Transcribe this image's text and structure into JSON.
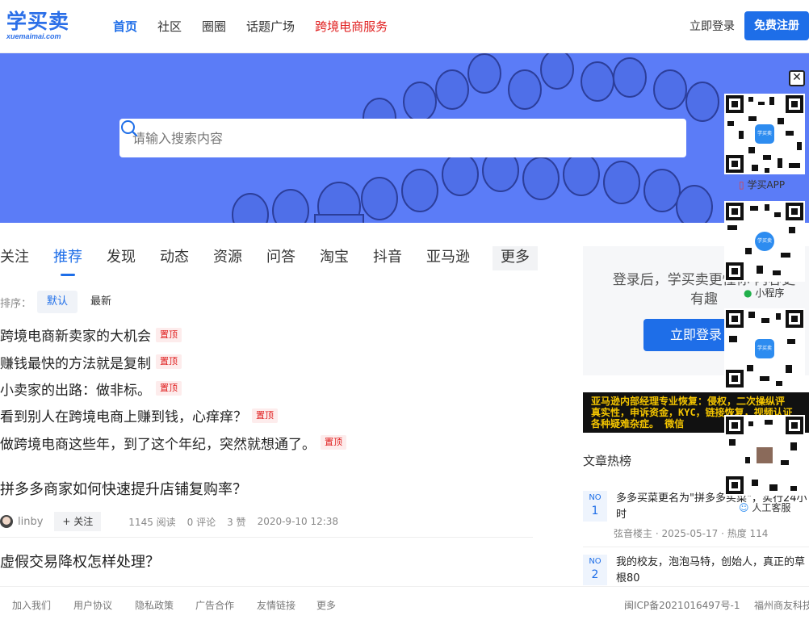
{
  "header": {
    "logo_main": "学买卖",
    "logo_sub": "xuemaimai.com",
    "nav": [
      "首页",
      "社区",
      "圈圈",
      "话题广场",
      "跨境电商服务"
    ],
    "login": "立即登录",
    "register": "免费注册"
  },
  "search": {
    "placeholder": "请输入搜索内容"
  },
  "tabs": [
    "关注",
    "推荐",
    "发现",
    "动态",
    "资源",
    "问答",
    "淘宝",
    "抖音",
    "亚马逊",
    "更多"
  ],
  "sort": {
    "label": "排序：",
    "options": [
      "默认",
      "最新"
    ]
  },
  "pinned": {
    "tag": "置顶",
    "items": [
      "跨境电商新卖家的大机会",
      "赚钱最快的方法就是复制",
      "小卖家的出路：做非标。",
      "看到别人在跨境电商上赚到钱，心痒痒？",
      "做跨境电商这些年，到了这个年纪，突然就想通了。"
    ]
  },
  "articles": [
    {
      "title": "拼多多商家如何快速提升店铺复购率？",
      "author": "linby",
      "follow": "+ 关注",
      "reads": "1145 阅读",
      "comments": "0 评论",
      "likes": "3 赞",
      "date": "2020-9-10 12:38"
    },
    {
      "title": "虚假交易降权怎样处理？",
      "author": "",
      "follow": "",
      "reads": "",
      "comments": "",
      "likes": "",
      "date": ""
    }
  ],
  "login_card": {
    "text": "登录后，学买卖更懂你 内容更有趣",
    "button": "立即登录"
  },
  "ad": {
    "line1": "亚马逊内部经理专业恢复：侵权，二次操纵评",
    "line2": "真实性，申诉资金，KYC，链接恢复，视频认证",
    "line3": "各种疑难杂症。        微信"
  },
  "hot": {
    "title": "文章热榜",
    "items": [
      {
        "no": "NO",
        "num": "1",
        "text": "多多买菜更名为\"拼多多买菜\"，实行24小时",
        "author": "弦音楼主",
        "date": "2025-05-17",
        "heat": "热度 114"
      },
      {
        "no": "NO",
        "num": "2",
        "text": "我的校友，泡泡马特，创始人，真正的草根80",
        "author": "",
        "date": "",
        "heat": ""
      }
    ]
  },
  "side": {
    "close": "✕",
    "app_label": "学买APP",
    "mini_label": "小程序",
    "service_label": "人工客服",
    "badge": "学买卖"
  },
  "footer": {
    "links": [
      "加入我们",
      "用户协议",
      "隐私政策",
      "广告合作",
      "友情链接",
      "更多"
    ],
    "icp": "闽ICP备2021016497号-1",
    "company": "福州商友科技"
  },
  "colors": {
    "brand": "#1e6ee8",
    "banner": "#5b7cf7",
    "pin": "#e02020"
  }
}
